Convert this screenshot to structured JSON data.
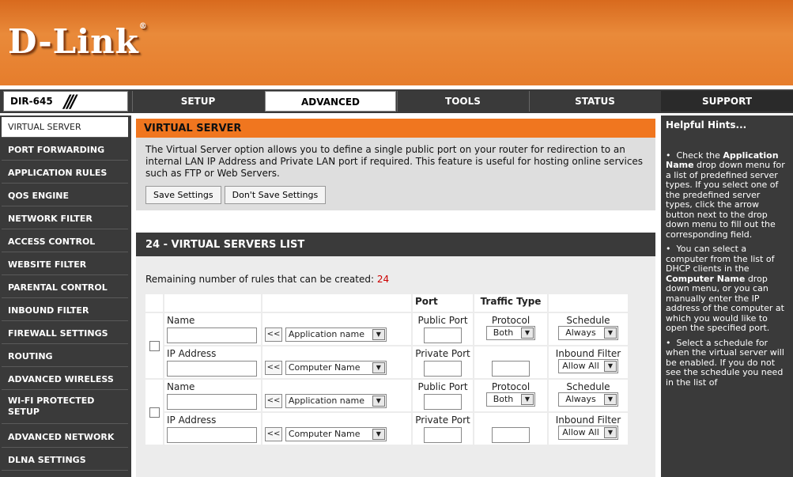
{
  "header": {
    "logo": "D-Link",
    "logo_mark": "®"
  },
  "nav": {
    "model": "DIR-645",
    "tabs": [
      "SETUP",
      "ADVANCED",
      "TOOLS",
      "STATUS"
    ],
    "active_tab": "ADVANCED",
    "support": "SUPPORT"
  },
  "sidebar": {
    "items": [
      "VIRTUAL SERVER",
      "PORT FORWARDING",
      "APPLICATION RULES",
      "QOS ENGINE",
      "NETWORK FILTER",
      "ACCESS CONTROL",
      "WEBSITE FILTER",
      "PARENTAL CONTROL",
      "INBOUND FILTER",
      "FIREWALL SETTINGS",
      "ROUTING",
      "ADVANCED WIRELESS",
      "WI-FI PROTECTED SETUP",
      "ADVANCED NETWORK",
      "DLNA SETTINGS"
    ],
    "active": "VIRTUAL SERVER"
  },
  "main": {
    "title": "VIRTUAL SERVER",
    "intro": "The Virtual Server option allows you to define a single public port on your router for redirection to an internal LAN IP Address and Private LAN port if required. This feature is useful for hosting online services such as FTP or Web Servers.",
    "save_label": "Save Settings",
    "dont_save_label": "Don't Save Settings",
    "list_title": "24 - VIRTUAL SERVERS LIST",
    "remaining_label": "Remaining number of rules that can be created:",
    "remaining_count": "24",
    "table": {
      "col_port": "Port",
      "col_traffic": "Traffic Type",
      "name_label": "Name",
      "ip_label": "IP Address",
      "public_port": "Public Port",
      "private_port": "Private Port",
      "protocol_label": "Protocol",
      "protocol_value": "Both",
      "schedule_label": "Schedule",
      "schedule_value": "Always",
      "inbound_label": "Inbound Filter",
      "inbound_value": "Allow All",
      "chevron": "<<",
      "app_name": "Application name",
      "computer_name": "Computer Name"
    }
  },
  "hints": {
    "title": "Helpful Hints...",
    "h1_pre": "Check the ",
    "h1_bold": "Application Name",
    "h1_post": " drop down menu for a list of predefined server types. If you select one of the predefined server types, click the arrow button next to the drop down menu to fill out the corresponding field.",
    "h2_pre": "You can select a computer from the list of DHCP clients in the ",
    "h2_bold": "Computer Name",
    "h2_post": " drop down menu, or you can manually enter the IP address of the computer at which you would like to open the specified port.",
    "h3": "Select a schedule for when the virtual server will be enabled. If you do not see the schedule you need in the list of"
  }
}
